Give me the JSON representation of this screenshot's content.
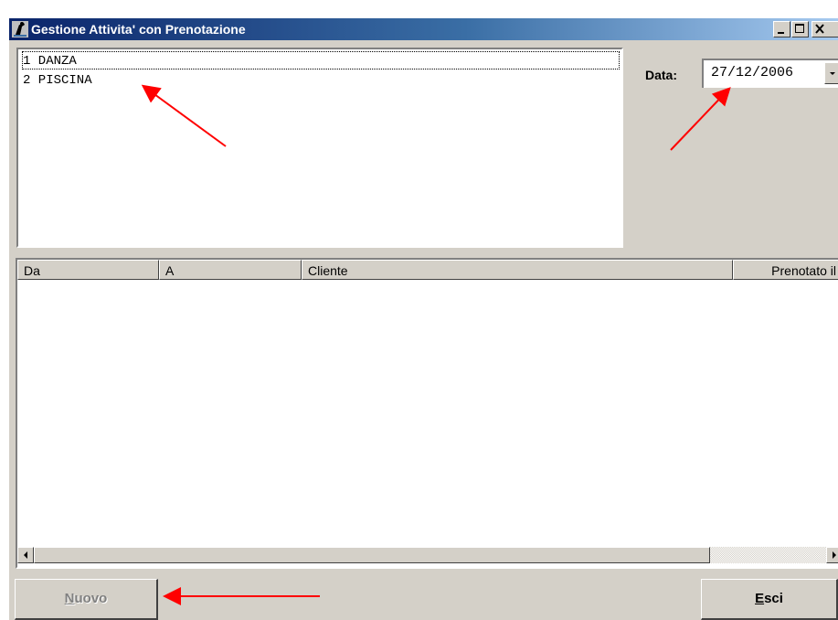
{
  "window": {
    "title": "Gestione Attivita' con Prenotazione",
    "icon": "app-icon",
    "controls": [
      "minimize-icon",
      "maximize-icon",
      "close-icon"
    ]
  },
  "activities": {
    "items": [
      {
        "label": "1 DANZA",
        "focused": true
      },
      {
        "label": "2 PISCINA",
        "focused": false
      }
    ]
  },
  "date": {
    "label": "Data:",
    "value": "27/12/2006"
  },
  "grid": {
    "columns": [
      "Da",
      "A",
      "Cliente",
      "Prenotato il"
    ],
    "rows": []
  },
  "buttons": {
    "new": {
      "mnemonic": "N",
      "rest": "uovo",
      "enabled": false
    },
    "exit": {
      "mnemonic": "E",
      "rest": "sci",
      "enabled": true
    }
  },
  "annotations": {
    "arrow_color": "#ff0000"
  },
  "colors": {
    "face": "#d4d0c8",
    "title_start": "#0a246a",
    "title_end": "#a6caf0"
  }
}
